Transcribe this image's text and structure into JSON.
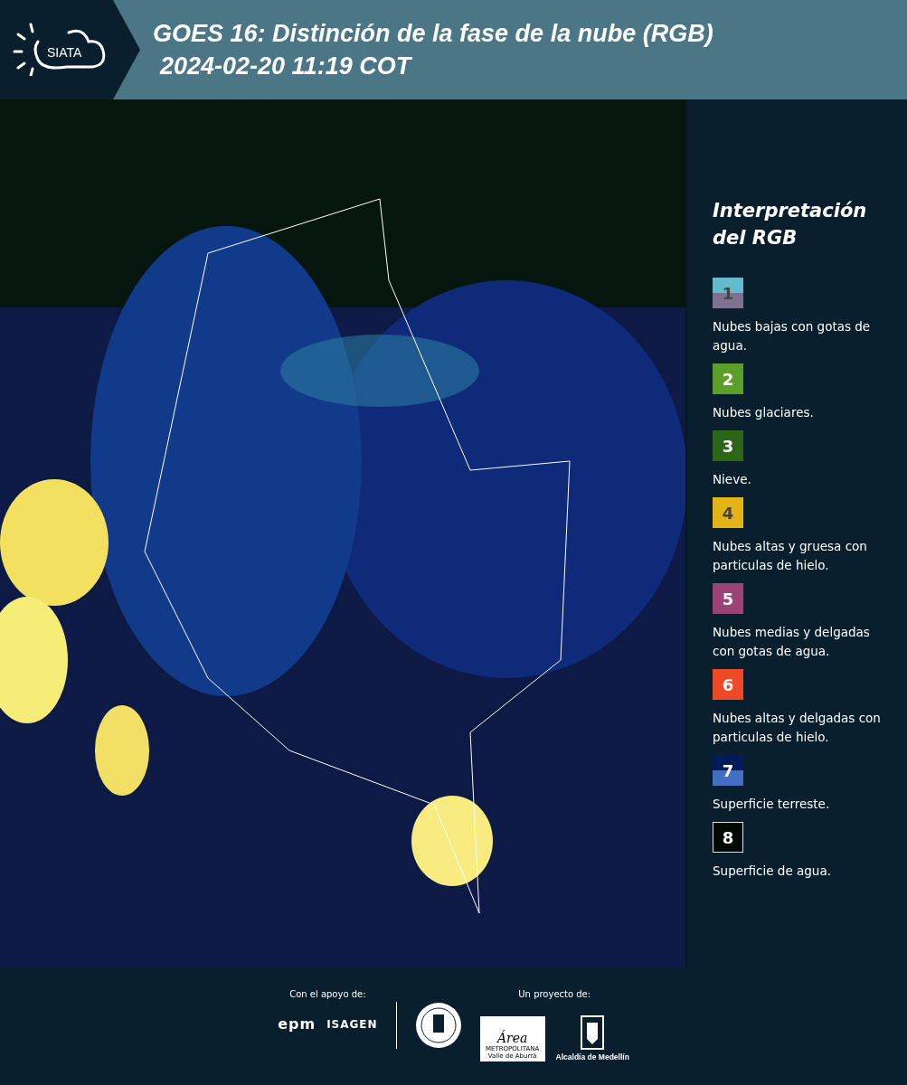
{
  "header": {
    "logo_text": "SIATA",
    "title": "GOES 16: Distinción de la fase de la nube (RGB)",
    "subtitle": "2024-02-20 11:19 COT"
  },
  "legend": {
    "title": "Interpretación del RGB",
    "items": [
      {
        "number": "1",
        "bands": [
          {
            "color": "#62bccb"
          },
          {
            "color": "#7e7290"
          }
        ],
        "label": "Nubes bajas con gotas de agua."
      },
      {
        "number": "2",
        "color": "#5c9e2a",
        "label": "Nubes glaciares."
      },
      {
        "number": "3",
        "color": "#2d6519",
        "label": "Nieve."
      },
      {
        "number": "4",
        "color": "#e2b416",
        "label": "Nubes altas y gruesa con particulas de hielo."
      },
      {
        "number": "5",
        "color": "#9c4375",
        "label": "Nubes medias y delgadas con gotas de agua."
      },
      {
        "number": "6",
        "color": "#ee4a28",
        "label": "Nubes altas y delgadas con particulas de hielo."
      },
      {
        "number": "7",
        "bands": [
          {
            "color": "#001b5a"
          },
          {
            "color": "#4470c2"
          }
        ],
        "label": "Superficie terreste."
      },
      {
        "number": "8",
        "color": "#000a04",
        "label": "Superficie de agua."
      }
    ]
  },
  "footer": {
    "support_label": "Con el apoyo de:",
    "support_logos": [
      "epm",
      "ISAGEN"
    ],
    "project_label": "Un proyecto de:",
    "area_logo": {
      "name": "Área",
      "line_1": "METROPOLITANA",
      "line_2": "Valle de Aburrá"
    },
    "alcaldia_logo": "Alcaldía de Medellín"
  }
}
